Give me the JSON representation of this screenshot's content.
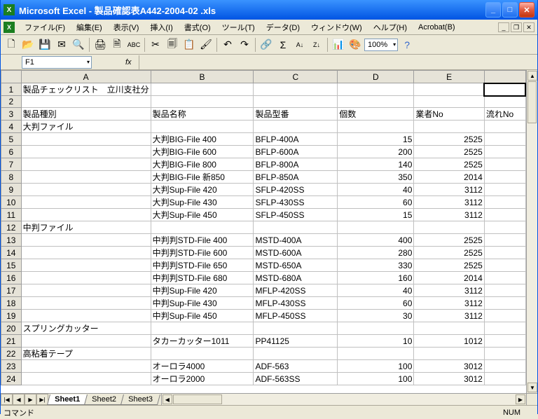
{
  "window": {
    "title": "Microsoft Excel - 製品確認表A442-2004-02 .xls"
  },
  "menu": {
    "file": "ファイル(F)",
    "edit": "編集(E)",
    "view": "表示(V)",
    "insert": "挿入(I)",
    "format": "書式(O)",
    "tools": "ツール(T)",
    "data": "データ(D)",
    "window": "ウィンドウ(W)",
    "help": "ヘルプ(H)",
    "acrobat": "Acrobat(B)"
  },
  "toolbar": {
    "zoom": "100%"
  },
  "namebox": "F1",
  "fx": "fx",
  "columns": [
    "A",
    "B",
    "C",
    "D",
    "E",
    ""
  ],
  "rowcount": 24,
  "sheet": {
    "title": "製品チェックリスト　立川支社分",
    "headers": {
      "kind": "製品種別",
      "name": "製品名称",
      "model": "製品型番",
      "qty": "個数",
      "vendor": "業者No",
      "flow": "流れNo"
    },
    "groups": [
      "大判ファイル",
      "中判ファイル",
      "スプリングカッター",
      "高粘着テープ"
    ]
  },
  "chart_data": {
    "type": "table",
    "columns": [
      "製品種別",
      "製品名称",
      "製品型番",
      "個数",
      "業者No"
    ],
    "rows": [
      {
        "r": 4,
        "kind": "大判ファイル"
      },
      {
        "r": 5,
        "name": "大判BIG-File 400",
        "model": "BFLP-400A",
        "qty": 15,
        "vendor": 2525
      },
      {
        "r": 6,
        "name": "大判BIG-File 600",
        "model": "BFLP-600A",
        "qty": 200,
        "vendor": 2525
      },
      {
        "r": 7,
        "name": "大判BIG-File 800",
        "model": "BFLP-800A",
        "qty": 140,
        "vendor": 2525
      },
      {
        "r": 8,
        "name": "大判BIG-File 新850",
        "model": "BFLP-850A",
        "qty": 350,
        "vendor": 2014
      },
      {
        "r": 9,
        "name": "大判Sup-File 420",
        "model": "SFLP-420SS",
        "qty": 40,
        "vendor": 3112
      },
      {
        "r": 10,
        "name": "大判Sup-File 430",
        "model": "SFLP-430SS",
        "qty": 60,
        "vendor": 3112
      },
      {
        "r": 11,
        "name": "大判Sup-File 450",
        "model": "SFLP-450SS",
        "qty": 15,
        "vendor": 3112
      },
      {
        "r": 12,
        "kind": "中判ファイル"
      },
      {
        "r": 13,
        "name": "中判判STD-File 400",
        "model": "MSTD-400A",
        "qty": 400,
        "vendor": 2525
      },
      {
        "r": 14,
        "name": "中判判STD-File 600",
        "model": "MSTD-600A",
        "qty": 280,
        "vendor": 2525
      },
      {
        "r": 15,
        "name": "中判判STD-File 650",
        "model": "MSTD-650A",
        "qty": 330,
        "vendor": 2525
      },
      {
        "r": 16,
        "name": "中判判STD-File 680",
        "model": "MSTD-680A",
        "qty": 160,
        "vendor": 2014
      },
      {
        "r": 17,
        "name": "中判Sup-File 420",
        "model": "MFLP-420SS",
        "qty": 40,
        "vendor": 3112
      },
      {
        "r": 18,
        "name": "中判Sup-File 430",
        "model": "MFLP-430SS",
        "qty": 60,
        "vendor": 3112
      },
      {
        "r": 19,
        "name": "中判Sup-File 450",
        "model": "MFLP-450SS",
        "qty": 30,
        "vendor": 3112
      },
      {
        "r": 20,
        "kind": "スプリングカッター"
      },
      {
        "r": 21,
        "name": "タカーカッター1011",
        "model": "PP41125",
        "qty": 10,
        "vendor": 1012
      },
      {
        "r": 22,
        "kind": "高粘着テープ"
      },
      {
        "r": 23,
        "name": "オーロラ4000",
        "model": "ADF-563",
        "qty": 100,
        "vendor": 3012
      },
      {
        "r": 24,
        "name": "オーロラ2000",
        "model": "ADF-563SS",
        "qty": 100,
        "vendor": 3012
      }
    ]
  },
  "tabs": {
    "sheet1": "Sheet1",
    "sheet2": "Sheet2",
    "sheet3": "Sheet3"
  },
  "status": {
    "cmd": "コマンド",
    "num": "NUM"
  }
}
